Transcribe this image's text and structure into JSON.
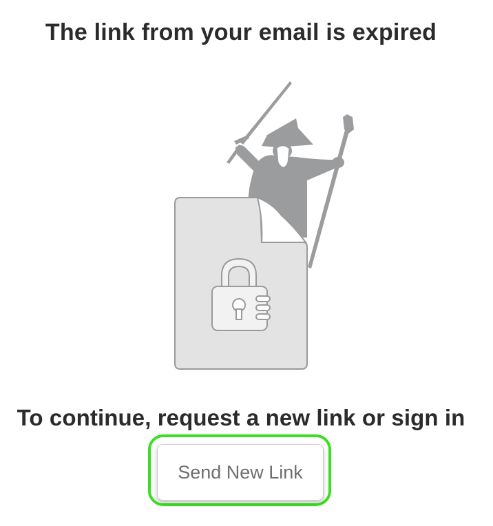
{
  "page": {
    "title": "The link from your email is expired",
    "message": "To continue, request a new link or sign in",
    "send_button_label": "Send New Link"
  },
  "illustration": {
    "icons": [
      "wizard-figure-icon",
      "locked-document-icon",
      "padlock-icon"
    ]
  },
  "colors": {
    "text": "#2b2b2b",
    "illustration_gray": "#9a9c9e",
    "document_fill": "#e3e3e4",
    "document_stroke": "#9a9a9a",
    "focus_ring": "#39e01f",
    "button_text": "#6e6e6e"
  }
}
